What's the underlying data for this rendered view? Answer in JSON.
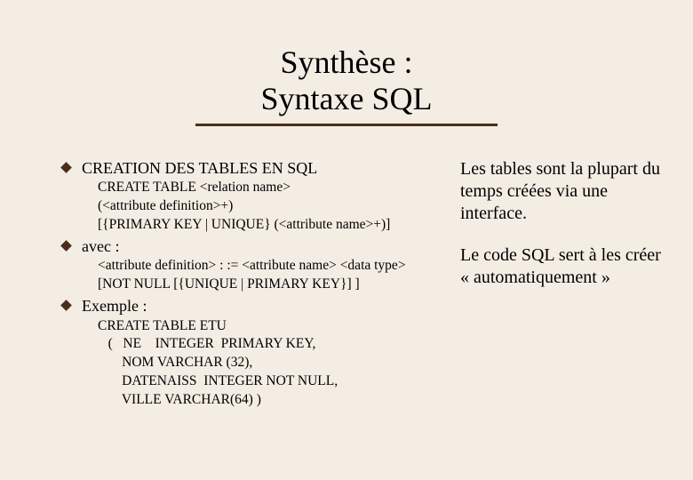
{
  "title": {
    "line1": "Synthèse :",
    "line2": "Syntaxe SQL"
  },
  "bullets": {
    "b1": {
      "heading": "CREATION DES TABLES EN SQL",
      "sub1": "CREATE TABLE <relation name>",
      "sub2": "(<attribute definition>+)",
      "sub3": "[{PRIMARY KEY | UNIQUE} (<attribute name>+)]"
    },
    "b2": {
      "heading": "avec :",
      "sub1": "<attribute definition> : :=  <attribute name> <data type>",
      "sub2": "[NOT NULL  [{UNIQUE | PRIMARY KEY}] ]"
    },
    "b3": {
      "heading": "Exemple :",
      "example": "CREATE TABLE ETU\n   (   NE    INTEGER  PRIMARY KEY,\n       NOM VARCHAR (32),\n       DATENAISS  INTEGER NOT NULL,\n       VILLE VARCHAR(64) )"
    }
  },
  "notes": {
    "n1": "Les tables sont la plupart du temps créées via une interface.",
    "n2": "Le code SQL sert à les créer « automatiquement »"
  }
}
